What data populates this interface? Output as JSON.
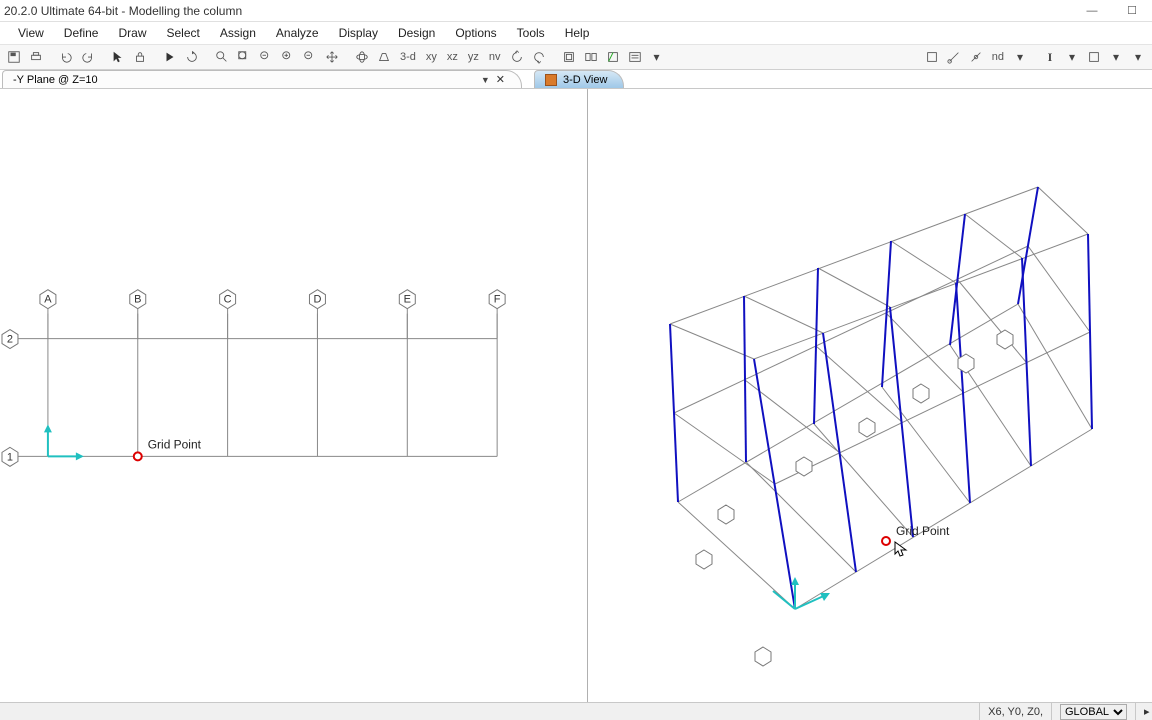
{
  "title": "20.2.0 Ultimate 64-bit - Modelling the column",
  "menus": [
    "View",
    "Define",
    "Draw",
    "Select",
    "Assign",
    "Analyze",
    "Display",
    "Design",
    "Options",
    "Tools",
    "Help"
  ],
  "toolbar_text": {
    "d3": "3-d",
    "xy": "xy",
    "xz": "xz",
    "yz": "yz",
    "nv": "nv",
    "nd": "nd"
  },
  "tabs": {
    "left": "-Y Plane @ Z=10",
    "right": "3-D View"
  },
  "left_view": {
    "grid_labels": [
      "A",
      "B",
      "C",
      "D",
      "E",
      "F"
    ],
    "row_labels_left": [
      "2",
      "1"
    ],
    "tooltip": "Grid Point"
  },
  "right_view": {
    "tooltip": "Grid Point"
  },
  "status": {
    "coords": "X6,  Y0,  Z0,",
    "coord_sys": "GLOBAL"
  }
}
